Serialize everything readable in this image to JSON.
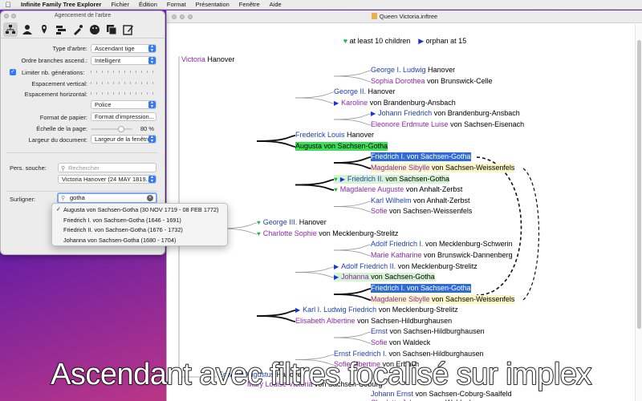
{
  "menubar": {
    "app_name": "Infinite Family Tree Explorer",
    "items": [
      "Fichier",
      "Édition",
      "Format",
      "Présentation",
      "Fenêtre",
      "Aide"
    ]
  },
  "left_panel": {
    "title": "Agencement de l'arbre",
    "toolbar_icons": [
      "tree-layout-icon",
      "person-icon",
      "map-pin-icon",
      "chart-icon",
      "paint-icon",
      "palette-icon",
      "copy-icon",
      "edit-icon"
    ],
    "fields": {
      "tree_type_label": "Type d'arbre:",
      "tree_type_value": "Ascendant tige",
      "branch_order_label": "Ordre branches ascend.:",
      "branch_order_value": "Intelligent",
      "limit_generations_label": "Limiter nb. générations:",
      "vertical_spacing_label": "Espacement vertical:",
      "horizontal_spacing_label": "Espacement horizontal:",
      "font_value": "Police",
      "paper_format_label": "Format de papier:",
      "paper_format_value": "Format d'impression...",
      "page_scale_label": "Échelle de la page:",
      "page_scale_value": "80 %",
      "doc_width_label": "Largeur du document:",
      "doc_width_value": "Largeur de la fenêtre",
      "root_person_label": "Pers. souche:",
      "search_placeholder": "Rechercher",
      "root_person_value": "Victoria Hanover (24 MAY 1819...",
      "highlight_label": "Surligner:",
      "highlight_value": "gotha"
    },
    "dropdown_options": [
      {
        "label": "Augusta von Sachsen-Gotha (30 NOV 1719 - 08 FEB 1772)",
        "checked": true
      },
      {
        "label": "Friedrich I. von Sachsen-Gotha (1646 - 1691)",
        "checked": false
      },
      {
        "label": "Friedrich II. von Sachsen-Gotha (1676 - 1732)",
        "checked": false
      },
      {
        "label": "Johanna von Sachsen-Gotha (1680 - 1704)",
        "checked": false
      }
    ]
  },
  "main_window": {
    "title": "Queen Victoria.inftree",
    "legend_heart": "at least 10 children",
    "legend_triangle": "orphan at 15"
  },
  "tree_nodes": [
    {
      "id": "victoria",
      "first": "Victoria",
      "last": "Hanover",
      "sex": "f"
    },
    {
      "id": "george_ludwig",
      "first": "George I. Ludwig",
      "last": "Hanover",
      "sex": "m"
    },
    {
      "id": "sophia_dorothea",
      "first": "Sophia Dorothea",
      "last": "von Brunswick-Celle",
      "sex": "f"
    },
    {
      "id": "george_ii",
      "first": "George II.",
      "last": "Hanover",
      "sex": "m"
    },
    {
      "id": "karoline",
      "first": "Karoline",
      "last": "von Brandenburg-Ansbach",
      "sex": "f",
      "marker": "triangle"
    },
    {
      "id": "johann_friedrich",
      "first": "Johann Friedrich",
      "last": "von Brandenburg-Ansbach",
      "sex": "m",
      "marker": "triangle"
    },
    {
      "id": "eleonore",
      "first": "Eleonore Erdmute Luise",
      "last": "von Sachsen-Eisenach",
      "sex": "f"
    },
    {
      "id": "frederick_louis",
      "first": "Frederick Louis",
      "last": "Hanover",
      "sex": "m"
    },
    {
      "id": "augusta",
      "first": "Augusta",
      "last": "von Sachsen-Gotha",
      "sex": "f",
      "highlight": "green"
    },
    {
      "id": "friedrich_i_a",
      "first": "Friedrich I.",
      "last": "von Sachsen-Gotha",
      "sex": "m",
      "highlight": "blue"
    },
    {
      "id": "magdalene_a",
      "first": "Magdalene Sibylle",
      "last": "von Sachsen-Weissenfels",
      "sex": "f",
      "highlight": "yellow"
    },
    {
      "id": "friedrich_ii",
      "first": "Friedrich II.",
      "last": "von Sachsen-Gotha",
      "sex": "m",
      "marker": "heart+triangle",
      "highlight": "lightgreen"
    },
    {
      "id": "magdalene_auguste",
      "first": "Magdalene Auguste",
      "last": "von Anhalt-Zerbst",
      "sex": "f",
      "marker": "heart"
    },
    {
      "id": "karl_wilhelm",
      "first": "Karl Wilhelm",
      "last": "von Anhalt-Zerbst",
      "sex": "m"
    },
    {
      "id": "sofie_sw",
      "first": "Sofie",
      "last": "von Sachsen-Weissenfels",
      "sex": "f"
    },
    {
      "id": "george_iii",
      "first": "George III.",
      "last": "Hanover",
      "sex": "m",
      "marker": "heart"
    },
    {
      "id": "charlotte_sophie",
      "first": "Charlotte Sophie",
      "last": "von Mecklenburg-Strelitz",
      "sex": "f",
      "marker": "heart"
    },
    {
      "id": "adolf_schwerin",
      "first": "Adolf Friedrich I.",
      "last": "von Mecklenburg-Schwerin",
      "sex": "m"
    },
    {
      "id": "marie_katharine",
      "first": "Marie Katharine",
      "last": "von Brunswick-Dannenberg",
      "sex": "f"
    },
    {
      "id": "adolf_ii",
      "first": "Adolf Friedrich II.",
      "last": "von Mecklenburg-Strelitz",
      "sex": "m",
      "marker": "triangle"
    },
    {
      "id": "johanna",
      "first": "Johanna",
      "last": "von Sachsen-Gotha",
      "sex": "f",
      "marker": "triangle",
      "highlight": "lightgreen"
    },
    {
      "id": "friedrich_i_b",
      "first": "Friedrich I.",
      "last": "von Sachsen-Gotha",
      "sex": "m",
      "highlight": "blue"
    },
    {
      "id": "magdalene_b",
      "first": "Magdalene Sibylle",
      "last": "von Sachsen-Weissenfels",
      "sex": "f",
      "highlight": "yellow"
    },
    {
      "id": "karl_ludwig",
      "first": "Karl I. Ludwig Friedrich",
      "last": "von Mecklenburg-Strelitz",
      "sex": "m",
      "marker": "triangle"
    },
    {
      "id": "elisabeth_albertine",
      "first": "Elisabeth Albertine",
      "last": "von Sachsen-Hildburghausen",
      "sex": "f"
    },
    {
      "id": "ernst",
      "first": "Ernst",
      "last": "von Sachsen-Hildburghausen",
      "sex": "m"
    },
    {
      "id": "sofie_waldeck",
      "first": "Sofie",
      "last": "von Waldeck",
      "sex": "f"
    },
    {
      "id": "ernst_friedrich",
      "first": "Ernst Friedrich I.",
      "last": "von Sachsen-Hildburghausen",
      "sex": "m"
    },
    {
      "id": "sofie_albertine",
      "first": "Sofie Albertine",
      "last": "von Erbach",
      "sex": "f"
    },
    {
      "id": "edward",
      "first": "Edward Augustus",
      "last": "Hanover",
      "sex": "m"
    },
    {
      "id": "mary_louise",
      "first": "Mary Louise Victoria",
      "last": "von Sachsen-Coburg",
      "sex": "f"
    },
    {
      "id": "johann_ernst",
      "first": "Johann Ernst",
      "last": "von Sachsen-Coburg-Saalfeld",
      "sex": "m"
    },
    {
      "id": "charlotte_johanna",
      "first": "Charlotte Johanna",
      "last": "von Waldeck",
      "sex": "f"
    }
  ],
  "caption": "Ascendant avec filtres focalisé sur implex"
}
